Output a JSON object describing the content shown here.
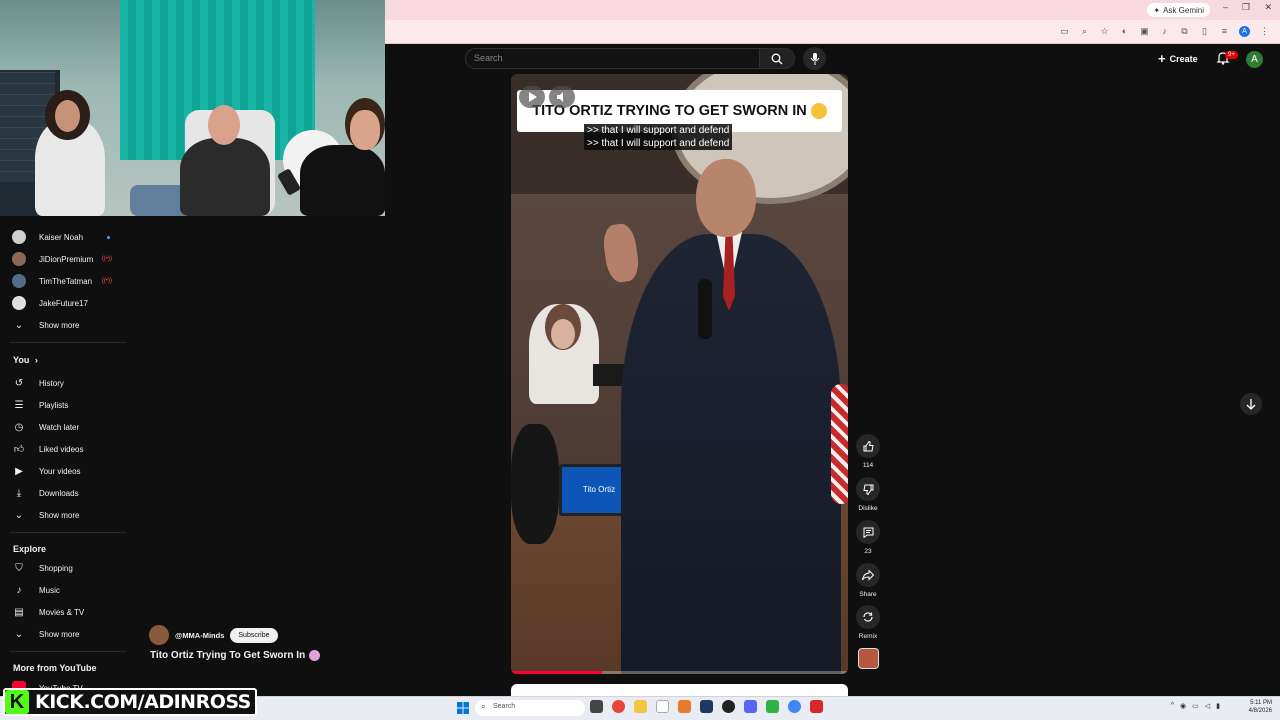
{
  "browser": {
    "ask_gemini": "Ask Gemini",
    "window_controls": [
      "–",
      "❐",
      "✕"
    ]
  },
  "youtube_header": {
    "search_placeholder": "Search",
    "create_label": "Create",
    "notification_count": "9+",
    "avatar_letter": "A"
  },
  "sidebar": {
    "subscriptions": [
      {
        "label": "Kaiser Noah",
        "indicator": "dot",
        "avatar_color": "#cfcfcf"
      },
      {
        "label": "JiDionPremium",
        "indicator": "live",
        "avatar_color": "#8a6a55"
      },
      {
        "label": "TimTheTatman",
        "indicator": "live",
        "avatar_color": "#556b8a"
      },
      {
        "label": "JakeFuture17",
        "indicator": "none",
        "avatar_color": "#e0e0e0"
      }
    ],
    "subs_show_more": "Show more",
    "you_heading": "You",
    "you_items": [
      {
        "label": "History",
        "icon": "history-icon"
      },
      {
        "label": "Playlists",
        "icon": "playlists-icon"
      },
      {
        "label": "Watch later",
        "icon": "clock-icon"
      },
      {
        "label": "Liked videos",
        "icon": "thumb-up-icon"
      },
      {
        "label": "Your videos",
        "icon": "video-icon"
      },
      {
        "label": "Downloads",
        "icon": "download-icon"
      }
    ],
    "you_show_more": "Show more",
    "explore_heading": "Explore",
    "explore_items": [
      {
        "label": "Shopping",
        "icon": "bag-icon"
      },
      {
        "label": "Music",
        "icon": "music-icon"
      },
      {
        "label": "Movies & TV",
        "icon": "film-icon"
      }
    ],
    "explore_show_more": "Show more",
    "more_heading": "More from YouTube",
    "more_partial": "YouTube TV"
  },
  "short": {
    "banner_title": "TITO ORTIZ TRYING TO GET SWORN IN",
    "captions": [
      ">> that I will support and defend",
      ">> that I will support and defend"
    ],
    "monitor_text": "Tito Ortiz",
    "progress_fraction": 0.27,
    "channel": "@MMA-Minds",
    "subscribe": "Subscribe",
    "title": "Tito Ortiz Trying To Get Sworn In"
  },
  "actions": {
    "like_count": "114",
    "dislike": "Dislike",
    "comments_count": "23",
    "share": "Share",
    "remix": "Remix"
  },
  "overlay": {
    "kick_text": "KICK.COM/ADINROSS",
    "kick_letter": "K"
  },
  "taskbar": {
    "search": "Search",
    "time": "5:11 PM",
    "date": "4/8/2026"
  },
  "colors": {
    "youtube_red": "#ff0033",
    "kick_green": "#53fc18",
    "live_red": "#ff4e45"
  }
}
